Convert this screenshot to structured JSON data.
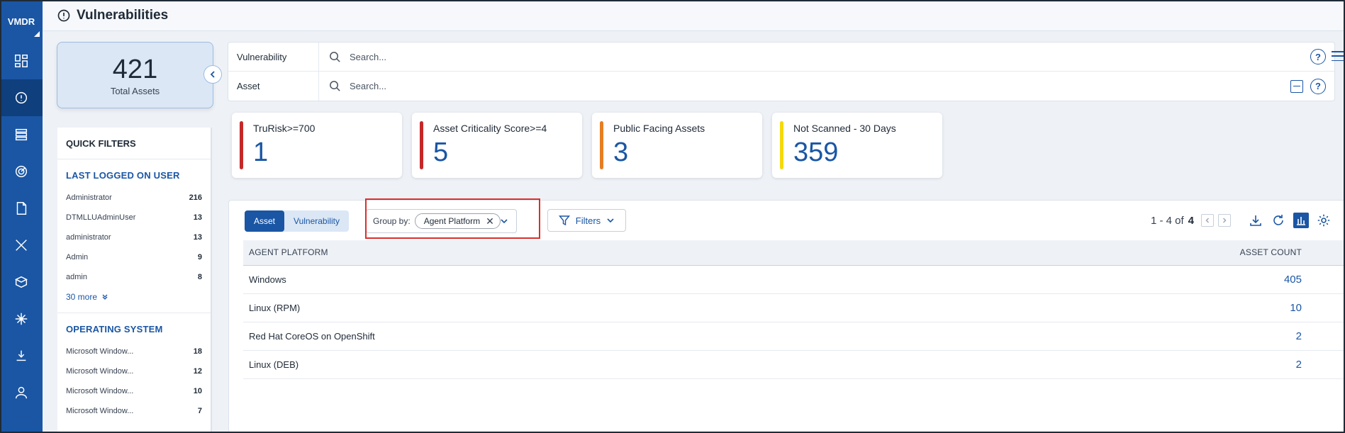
{
  "app": {
    "brand": "VMDR"
  },
  "header": {
    "title": "Vulnerabilities"
  },
  "nav": [
    {
      "icon": "dashboard-icon"
    },
    {
      "icon": "vulnerability-icon",
      "active": true
    },
    {
      "icon": "inventory-icon"
    },
    {
      "icon": "radar-icon"
    },
    {
      "icon": "document-icon"
    },
    {
      "icon": "tools-icon"
    },
    {
      "icon": "package-icon"
    },
    {
      "icon": "network-icon"
    },
    {
      "icon": "patch-icon"
    },
    {
      "icon": "user-icon"
    }
  ],
  "total_assets": {
    "value": "421",
    "label": "Total Assets"
  },
  "search": {
    "vulnerability": {
      "label": "Vulnerability",
      "placeholder": "Search..."
    },
    "asset": {
      "label": "Asset",
      "placeholder": "Search..."
    }
  },
  "kpis": [
    {
      "label": "TruRisk>=700",
      "value": "1",
      "color": "#c62828"
    },
    {
      "label": "Asset Criticality Score>=4",
      "value": "5",
      "color": "#c62828"
    },
    {
      "label": "Public Facing Assets",
      "value": "3",
      "color": "#e67e22"
    },
    {
      "label": "Not Scanned - 30 Days",
      "value": "359",
      "color": "#f5d90a"
    }
  ],
  "quick_filters": {
    "title": "QUICK FILTERS",
    "last_logged_on_user": {
      "title": "LAST LOGGED ON USER",
      "items": [
        {
          "label": "Administrator",
          "count": "216"
        },
        {
          "label": "DTMLLUAdminUser",
          "count": "13"
        },
        {
          "label": "administrator",
          "count": "13"
        },
        {
          "label": "Admin",
          "count": "9"
        },
        {
          "label": "admin",
          "count": "8"
        }
      ],
      "more": "30 more"
    },
    "operating_system": {
      "title": "OPERATING SYSTEM",
      "items": [
        {
          "label": "Microsoft Window...",
          "count": "18"
        },
        {
          "label": "Microsoft Window...",
          "count": "12"
        },
        {
          "label": "Microsoft Window...",
          "count": "10"
        },
        {
          "label": "Microsoft Window...",
          "count": "7"
        }
      ]
    }
  },
  "main": {
    "toggle": {
      "asset": "Asset",
      "vulnerability": "Vulnerability",
      "active": "asset"
    },
    "group_by": {
      "label": "Group by:",
      "chip": "Agent Platform"
    },
    "filters_label": "Filters",
    "pagination": {
      "range": "1 - 4 of",
      "total": "4"
    },
    "table": {
      "columns": [
        "AGENT PLATFORM",
        "ASSET COUNT"
      ],
      "rows": [
        {
          "platform": "Windows",
          "count": "405"
        },
        {
          "platform": "Linux (RPM)",
          "count": "10"
        },
        {
          "platform": "Red Hat CoreOS on OpenShift",
          "count": "2"
        },
        {
          "platform": "Linux (DEB)",
          "count": "2"
        }
      ]
    }
  }
}
